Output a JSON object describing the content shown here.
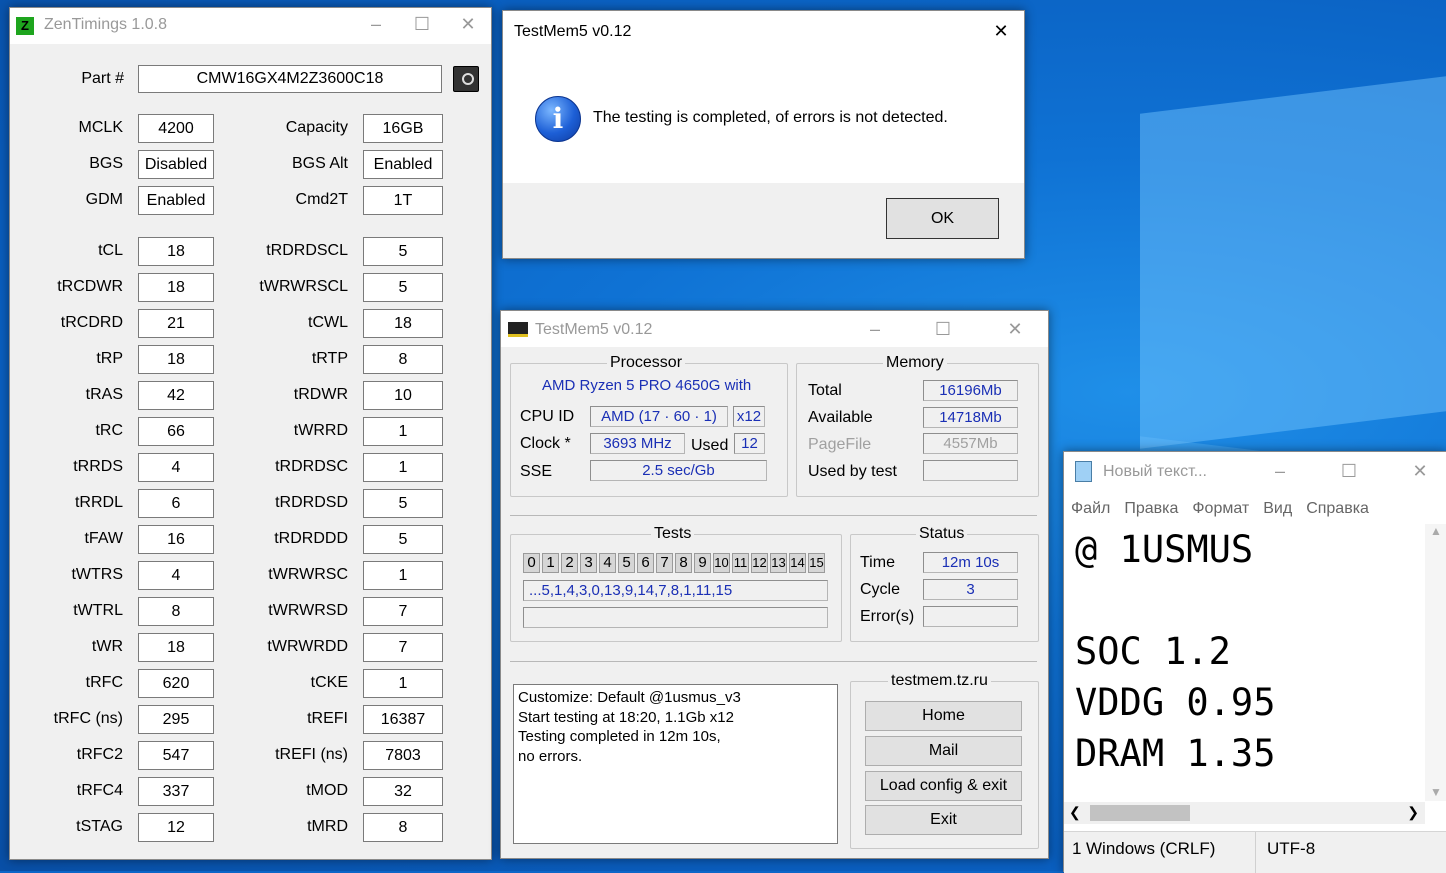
{
  "zentimings": {
    "title": "ZenTimings 1.0.8",
    "app_icon_glyph": "Z",
    "part_label": "Part #",
    "part_value": "CMW16GX4M2Z3600C18",
    "left_col": [
      {
        "label": "MCLK",
        "value": "4200"
      },
      {
        "label": "BGS",
        "value": "Disabled"
      },
      {
        "label": "GDM",
        "value": "Enabled"
      },
      {
        "label": "tCL",
        "value": "18"
      },
      {
        "label": "tRCDWR",
        "value": "18"
      },
      {
        "label": "tRCDRD",
        "value": "21"
      },
      {
        "label": "tRP",
        "value": "18"
      },
      {
        "label": "tRAS",
        "value": "42"
      },
      {
        "label": "tRC",
        "value": "66"
      },
      {
        "label": "tRRDS",
        "value": "4"
      },
      {
        "label": "tRRDL",
        "value": "6"
      },
      {
        "label": "tFAW",
        "value": "16"
      },
      {
        "label": "tWTRS",
        "value": "4"
      },
      {
        "label": "tWTRL",
        "value": "8"
      },
      {
        "label": "tWR",
        "value": "18"
      },
      {
        "label": "tRFC",
        "value": "620"
      },
      {
        "label": "tRFC (ns)",
        "value": "295"
      },
      {
        "label": "tRFC2",
        "value": "547"
      },
      {
        "label": "tRFC4",
        "value": "337"
      },
      {
        "label": "tSTAG",
        "value": "12"
      }
    ],
    "right_col": [
      {
        "label": "Capacity",
        "value": "16GB"
      },
      {
        "label": "BGS Alt",
        "value": "Enabled"
      },
      {
        "label": "Cmd2T",
        "value": "1T"
      },
      {
        "label": "tRDRDSCL",
        "value": "5"
      },
      {
        "label": "tWRWRSCL",
        "value": "5"
      },
      {
        "label": "tCWL",
        "value": "18"
      },
      {
        "label": "tRTP",
        "value": "8"
      },
      {
        "label": "tRDWR",
        "value": "10"
      },
      {
        "label": "tWRRD",
        "value": "1"
      },
      {
        "label": "tRDRDSC",
        "value": "1"
      },
      {
        "label": "tRDRDSD",
        "value": "5"
      },
      {
        "label": "tRDRDDD",
        "value": "5"
      },
      {
        "label": "tWRWRSC",
        "value": "1"
      },
      {
        "label": "tWRWRSD",
        "value": "7"
      },
      {
        "label": "tWRWRDD",
        "value": "7"
      },
      {
        "label": "tCKE",
        "value": "1"
      },
      {
        "label": "tREFI",
        "value": "16387"
      },
      {
        "label": "tREFI (ns)",
        "value": "7803"
      },
      {
        "label": "tMOD",
        "value": "32"
      },
      {
        "label": "tMRD",
        "value": "8"
      }
    ]
  },
  "dialog": {
    "title": "TestMem5 v0.12",
    "message": "The testing is completed, of errors is not detected.",
    "ok_label": "OK",
    "icon_glyph": "i"
  },
  "testmem": {
    "title": "TestMem5 v0.12",
    "processor": {
      "heading": "Processor",
      "name": "AMD Ryzen 5 PRO 4650G with",
      "cpuid_label": "CPU ID",
      "cpuid_value": "AMD  (17 · 60 · 1)",
      "cpuid_threads": "x12",
      "clock_label": "Clock *",
      "clock_value": "3693 MHz",
      "used_label": "Used",
      "used_value": "12",
      "sse_label": "SSE",
      "sse_value": "2.5 sec/Gb"
    },
    "memory": {
      "heading": "Memory",
      "total_label": "Total",
      "total_value": "16196Mb",
      "available_label": "Available",
      "available_value": "14718Mb",
      "pagefile_label": "PageFile",
      "pagefile_value": "4557Mb",
      "usedbytest_label": "Used by test",
      "usedbytest_value": ""
    },
    "tests": {
      "heading": "Tests",
      "cells": [
        "0",
        "1",
        "2",
        "3",
        "4",
        "5",
        "6",
        "7",
        "8",
        "9",
        "10",
        "11",
        "12",
        "13",
        "14",
        "15"
      ],
      "sequence": "...5,1,4,3,0,13,9,14,7,8,1,11,15"
    },
    "status": {
      "heading": "Status",
      "time_label": "Time",
      "time_value": "12m 10s",
      "cycle_label": "Cycle",
      "cycle_value": "3",
      "errors_label": "Error(s)",
      "errors_value": ""
    },
    "log_lines": [
      "Customize: Default @1usmus_v3",
      "Start testing at 18:20, 1.1Gb x12",
      "Testing completed in 12m 10s,",
      "no errors."
    ],
    "site_heading": "testmem.tz.ru",
    "buttons": {
      "home": "Home",
      "mail": "Mail",
      "load": "Load config & exit",
      "exit": "Exit"
    }
  },
  "notepad": {
    "title": "Новый текст...",
    "menu": [
      "Файл",
      "Правка",
      "Формат",
      "Вид",
      "Справка"
    ],
    "lines": [
      "@ 1USMUS",
      "",
      "SOC 1.2",
      "VDDG 0.95",
      "DRAM 1.35"
    ],
    "status_pos": "1",
    "status_eol": "Windows (CRLF)",
    "status_enc": "UTF-8"
  },
  "colors": {
    "desktop": "#0b66c8",
    "value_blue": "#1a2fb5",
    "zen_green": "#1ea51e"
  }
}
